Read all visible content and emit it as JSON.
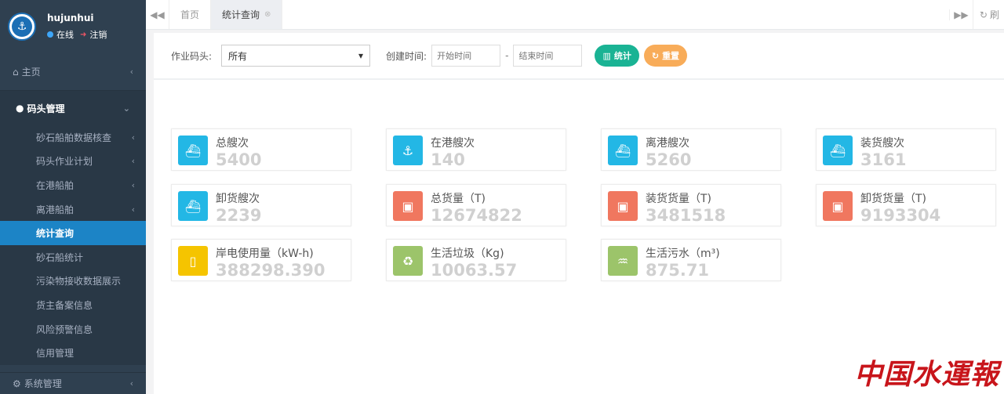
{
  "sidebar": {
    "username": "hujunhui",
    "status_online": "在线",
    "status_logout": "注销",
    "home": "主页",
    "group_title": "码头管理",
    "items": [
      {
        "label": "砂石船舶数据核查",
        "chev": true,
        "active": false
      },
      {
        "label": "码头作业计划",
        "chev": true,
        "active": false
      },
      {
        "label": "在港船舶",
        "chev": true,
        "active": false
      },
      {
        "label": "离港船舶",
        "chev": true,
        "active": false
      },
      {
        "label": "统计查询",
        "chev": false,
        "active": true
      },
      {
        "label": "砂石船统计",
        "chev": false,
        "active": false
      },
      {
        "label": "污染物接收数据展示",
        "chev": false,
        "active": false
      },
      {
        "label": "货主备案信息",
        "chev": false,
        "active": false
      },
      {
        "label": "风险预警信息",
        "chev": false,
        "active": false
      },
      {
        "label": "信用管理",
        "chev": false,
        "active": false
      }
    ],
    "system": "系统管理"
  },
  "tabs": {
    "home": "首页",
    "active": "统计查询",
    "refresh": "刷"
  },
  "filters": {
    "terminal_label": "作业码头:",
    "terminal_value": "所有",
    "time_label": "创建时间:",
    "start_placeholder": "开始时间",
    "end_placeholder": "结束时间",
    "dash": "-",
    "stat_button": "统计",
    "reset_button": "重置"
  },
  "cards": [
    {
      "label": "总艘次",
      "value": "5400",
      "color": "#23b7e5",
      "icon": "ship-icon"
    },
    {
      "label": "在港艘次",
      "value": "140",
      "color": "#23b7e5",
      "icon": "anchor-ship-icon"
    },
    {
      "label": "离港艘次",
      "value": "5260",
      "color": "#23b7e5",
      "icon": "departure-icon"
    },
    {
      "label": "装货艘次",
      "value": "3161",
      "color": "#23b7e5",
      "icon": "loading-ship-icon"
    },
    {
      "label": "卸货艘次",
      "value": "2239",
      "color": "#23b7e5",
      "icon": "unloading-ship-icon"
    },
    {
      "label": "总货量（T)",
      "value": "12674822",
      "color": "#f0775f",
      "icon": "cargo-box-icon"
    },
    {
      "label": "装货货量（T)",
      "value": "3481518",
      "color": "#f0775f",
      "icon": "load-box-icon"
    },
    {
      "label": "卸货货量（T)",
      "value": "9193304",
      "color": "#f0775f",
      "icon": "unload-box-icon"
    },
    {
      "label": "岸电使用量（kW-h)",
      "value": "388298.390",
      "color": "#f5c400",
      "icon": "battery-icon"
    },
    {
      "label": "生活垃圾（Kg)",
      "value": "10063.57",
      "color": "#9cc46a",
      "icon": "trash-icon"
    },
    {
      "label": "生活污水（m³)",
      "value": "875.71",
      "color": "#9cc46a",
      "icon": "water-icon"
    }
  ],
  "watermark": "中国水运报"
}
